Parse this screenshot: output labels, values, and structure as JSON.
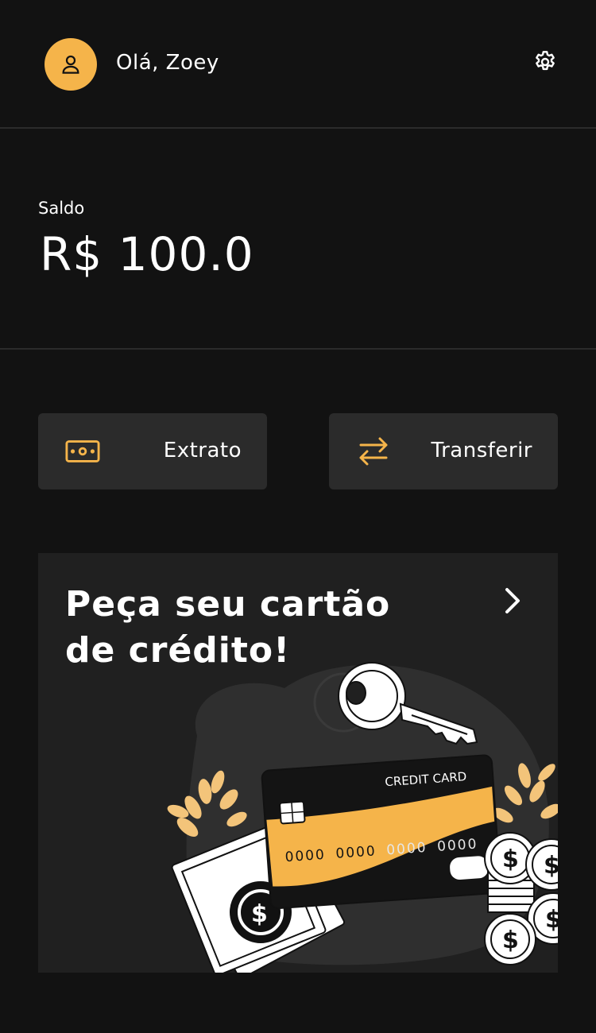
{
  "header": {
    "greeting": "Olá, Zoey",
    "avatar_icon": "user-icon",
    "settings_icon": "gear-icon"
  },
  "balance": {
    "label": "Saldo",
    "value": "R$ 100.0"
  },
  "actions": [
    {
      "label": "Extrato",
      "icon": "cash-icon"
    },
    {
      "label": "Transferir",
      "icon": "transfer-arrows-icon"
    }
  ],
  "promo": {
    "title": "Peça seu cartão de crédito!",
    "chevron_icon": "chevron-right-icon",
    "card_label": "CREDIT CARD",
    "card_numbers": [
      "0000",
      "0000",
      "0000",
      "0000"
    ]
  },
  "colors": {
    "background": "#121212",
    "surface": "#2b2b2b",
    "accent": "#f5b44a",
    "text": "#ffffff"
  }
}
